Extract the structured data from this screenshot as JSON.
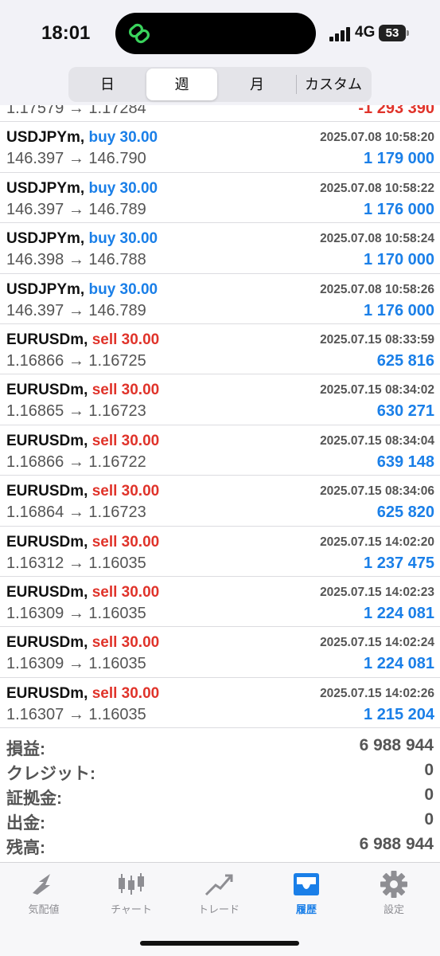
{
  "status_bar": {
    "time": "18:01",
    "network": "4G",
    "battery": "53"
  },
  "period_tabs": [
    {
      "label": "日",
      "active": false
    },
    {
      "label": "週",
      "active": true
    },
    {
      "label": "月",
      "active": false
    },
    {
      "label": "カスタム",
      "active": false
    }
  ],
  "partial_row": {
    "prices": "1.17579 → 1.17284",
    "profit": "-1 293 390"
  },
  "trades": [
    {
      "symbol": "USDJPYm,",
      "side": "buy 30.00",
      "type": "buy",
      "time": "2025.07.08 10:58:20",
      "prices": "146.397 → 146.790",
      "profit": "1 179 000"
    },
    {
      "symbol": "USDJPYm,",
      "side": "buy 30.00",
      "type": "buy",
      "time": "2025.07.08 10:58:22",
      "prices": "146.397 → 146.789",
      "profit": "1 176 000"
    },
    {
      "symbol": "USDJPYm,",
      "side": "buy 30.00",
      "type": "buy",
      "time": "2025.07.08 10:58:24",
      "prices": "146.398 → 146.788",
      "profit": "1 170 000"
    },
    {
      "symbol": "USDJPYm,",
      "side": "buy 30.00",
      "type": "buy",
      "time": "2025.07.08 10:58:26",
      "prices": "146.397 → 146.789",
      "profit": "1 176 000"
    },
    {
      "symbol": "EURUSDm,",
      "side": "sell 30.00",
      "type": "sell",
      "time": "2025.07.15 08:33:59",
      "prices": "1.16866 → 1.16725",
      "profit": "625 816"
    },
    {
      "symbol": "EURUSDm,",
      "side": "sell 30.00",
      "type": "sell",
      "time": "2025.07.15 08:34:02",
      "prices": "1.16865 → 1.16723",
      "profit": "630 271"
    },
    {
      "symbol": "EURUSDm,",
      "side": "sell 30.00",
      "type": "sell",
      "time": "2025.07.15 08:34:04",
      "prices": "1.16866 → 1.16722",
      "profit": "639 148"
    },
    {
      "symbol": "EURUSDm,",
      "side": "sell 30.00",
      "type": "sell",
      "time": "2025.07.15 08:34:06",
      "prices": "1.16864 → 1.16723",
      "profit": "625 820"
    },
    {
      "symbol": "EURUSDm,",
      "side": "sell 30.00",
      "type": "sell",
      "time": "2025.07.15 14:02:20",
      "prices": "1.16312 → 1.16035",
      "profit": "1 237 475"
    },
    {
      "symbol": "EURUSDm,",
      "side": "sell 30.00",
      "type": "sell",
      "time": "2025.07.15 14:02:23",
      "prices": "1.16309 → 1.16035",
      "profit": "1 224 081"
    },
    {
      "symbol": "EURUSDm,",
      "side": "sell 30.00",
      "type": "sell",
      "time": "2025.07.15 14:02:24",
      "prices": "1.16309 → 1.16035",
      "profit": "1 224 081"
    },
    {
      "symbol": "EURUSDm,",
      "side": "sell 30.00",
      "type": "sell",
      "time": "2025.07.15 14:02:26",
      "prices": "1.16307 → 1.16035",
      "profit": "1 215 204"
    }
  ],
  "summary": [
    {
      "label": "損益:",
      "value": "6 988 944"
    },
    {
      "label": "クレジット:",
      "value": "0"
    },
    {
      "label": "証拠金:",
      "value": "0"
    },
    {
      "label": "出金:",
      "value": "0"
    },
    {
      "label": "残高:",
      "value": "6 988 944"
    }
  ],
  "tabbar": [
    {
      "label": "気配値",
      "icon": "quotes-icon",
      "active": false
    },
    {
      "label": "チャート",
      "icon": "chart-icon",
      "active": false
    },
    {
      "label": "トレード",
      "icon": "trade-icon",
      "active": false
    },
    {
      "label": "履歴",
      "icon": "history-icon",
      "active": true
    },
    {
      "label": "設定",
      "icon": "settings-icon",
      "active": false
    }
  ],
  "colors": {
    "buy": "#1a7fe8",
    "sell": "#e0332a",
    "accent": "#1a7fe8"
  }
}
